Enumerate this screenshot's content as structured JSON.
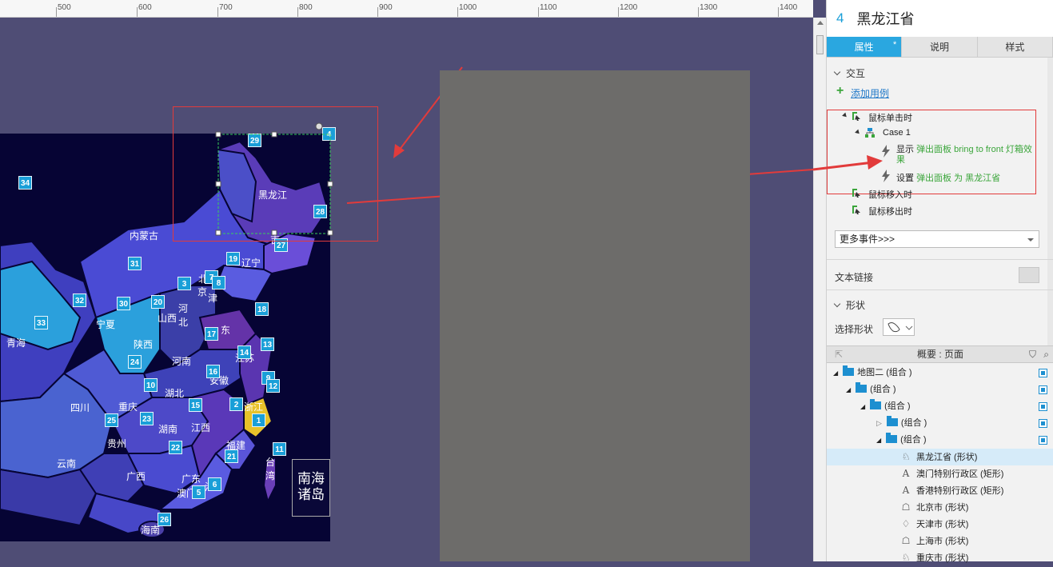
{
  "ruler": {
    "ticks": [
      "500",
      "600",
      "700",
      "800",
      "900",
      "1000",
      "1100",
      "1200",
      "1300",
      "1400"
    ]
  },
  "map": {
    "provinces": [
      "黑龙江",
      "内蒙古",
      "吉",
      "辽宁",
      "北",
      "京",
      "津",
      "河",
      "北",
      "山西",
      "宁夏",
      "陕西",
      "青海",
      "河南",
      "东",
      "江苏",
      "安徽",
      "湖北",
      "四川",
      "重庆",
      "浙江",
      "湖南",
      "江西",
      "贵州",
      "福建",
      "台",
      "湾",
      "云南",
      "广西",
      "广东",
      "澳门",
      "港",
      "海南"
    ],
    "badges": [
      "29",
      "4",
      "28",
      "27",
      "34",
      "19",
      "31",
      "3",
      "7",
      "8",
      "32",
      "30",
      "20",
      "18",
      "33",
      "17",
      "13",
      "14",
      "24",
      "16",
      "9",
      "12",
      "10",
      "2",
      "15",
      "1",
      "25",
      "23",
      "22",
      "21",
      "11",
      "6",
      "5",
      "26"
    ],
    "nanhai": "南海诸岛"
  },
  "panel": {
    "index": "4",
    "title": "黑龙江省",
    "tabs": [
      "属性",
      "说明",
      "样式"
    ],
    "tab_star": "*",
    "interaction": {
      "header": "交互",
      "add_case": "添加用例",
      "on_click": "鼠标单击时",
      "case": "Case 1",
      "action1_verb": "显示",
      "action1_target": "弹出面板 bring to front 灯箱效果",
      "action2_verb": "设置",
      "action2_target": "弹出面板 为 黑龙江省",
      "on_mouse_enter": "鼠标移入时",
      "on_mouse_leave": "鼠标移出时",
      "more_events": "更多事件>>>"
    },
    "text_link": "文本链接",
    "shape": {
      "header": "形状",
      "select_shape": "选择形状"
    },
    "outline": {
      "title": "概要 : 页面",
      "items": [
        {
          "label": "地图二 (组合 )",
          "type": "folder"
        },
        {
          "label": "(组合 )",
          "type": "folder"
        },
        {
          "label": "(组合 )",
          "type": "folder"
        },
        {
          "label": "(组合 )",
          "type": "folder"
        },
        {
          "label": "(组合 )",
          "type": "folder"
        },
        {
          "label": "黑龙江省 (形状)",
          "type": "shape"
        },
        {
          "label": "澳门特别行政区 (矩形)",
          "type": "text"
        },
        {
          "label": "香港特别行政区 (矩形)",
          "type": "text"
        },
        {
          "label": "北京市 (形状)",
          "type": "shape"
        },
        {
          "label": "天津市 (形状)",
          "type": "shape"
        },
        {
          "label": "上海市 (形状)",
          "type": "shape"
        },
        {
          "label": "重庆市 (形状)",
          "type": "shape"
        }
      ]
    }
  },
  "colors": {
    "canvas": "#4f4d75",
    "map_bg": "#060434",
    "accent": "#2aa7e0",
    "highlight_red": "#e23b3b",
    "zhejiang": "#e8c22a"
  }
}
